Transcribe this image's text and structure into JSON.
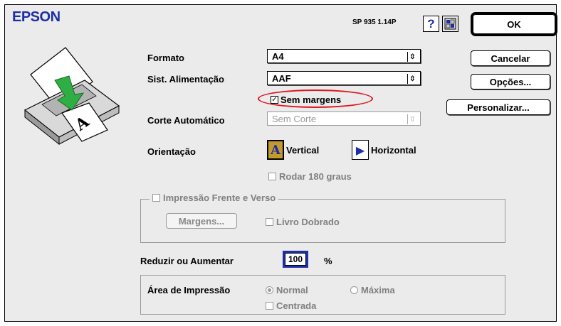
{
  "header": {
    "brand": "EPSON",
    "version": "SP 935 1.14P",
    "help_symbol": "?"
  },
  "buttons": {
    "ok": "OK",
    "cancel": "Cancelar",
    "options": "Opções...",
    "customize": "Personalizar..."
  },
  "form": {
    "format_label": "Formato",
    "format_value": "A4",
    "feed_label": "Sist. Alimentação",
    "feed_value": "AAF",
    "borderless_label": "Sem margens",
    "borderless_checked": true,
    "auto_cut_label": "Corte Automático",
    "auto_cut_value": "Sem Corte",
    "orientation_label": "Orientação",
    "portrait_label": "Vertical",
    "landscape_label": "Horizontal",
    "rotate_label": "Rodar 180 graus",
    "duplex_label": "Impressão Frente e Verso",
    "margins_button": "Margens...",
    "folded_book_label": "Livro Dobrado",
    "scale_label": "Reduzir ou Aumentar",
    "scale_value": "100",
    "scale_unit": "%",
    "print_area_label": "Área de Impressão",
    "area_normal": "Normal",
    "area_max": "Máxima",
    "centered_label": "Centrada"
  },
  "colors": {
    "brand_blue": "#1d2ea8",
    "highlight_red": "#e0141e",
    "arrow_green": "#2fae44"
  },
  "printer_icon_glyph": "A"
}
